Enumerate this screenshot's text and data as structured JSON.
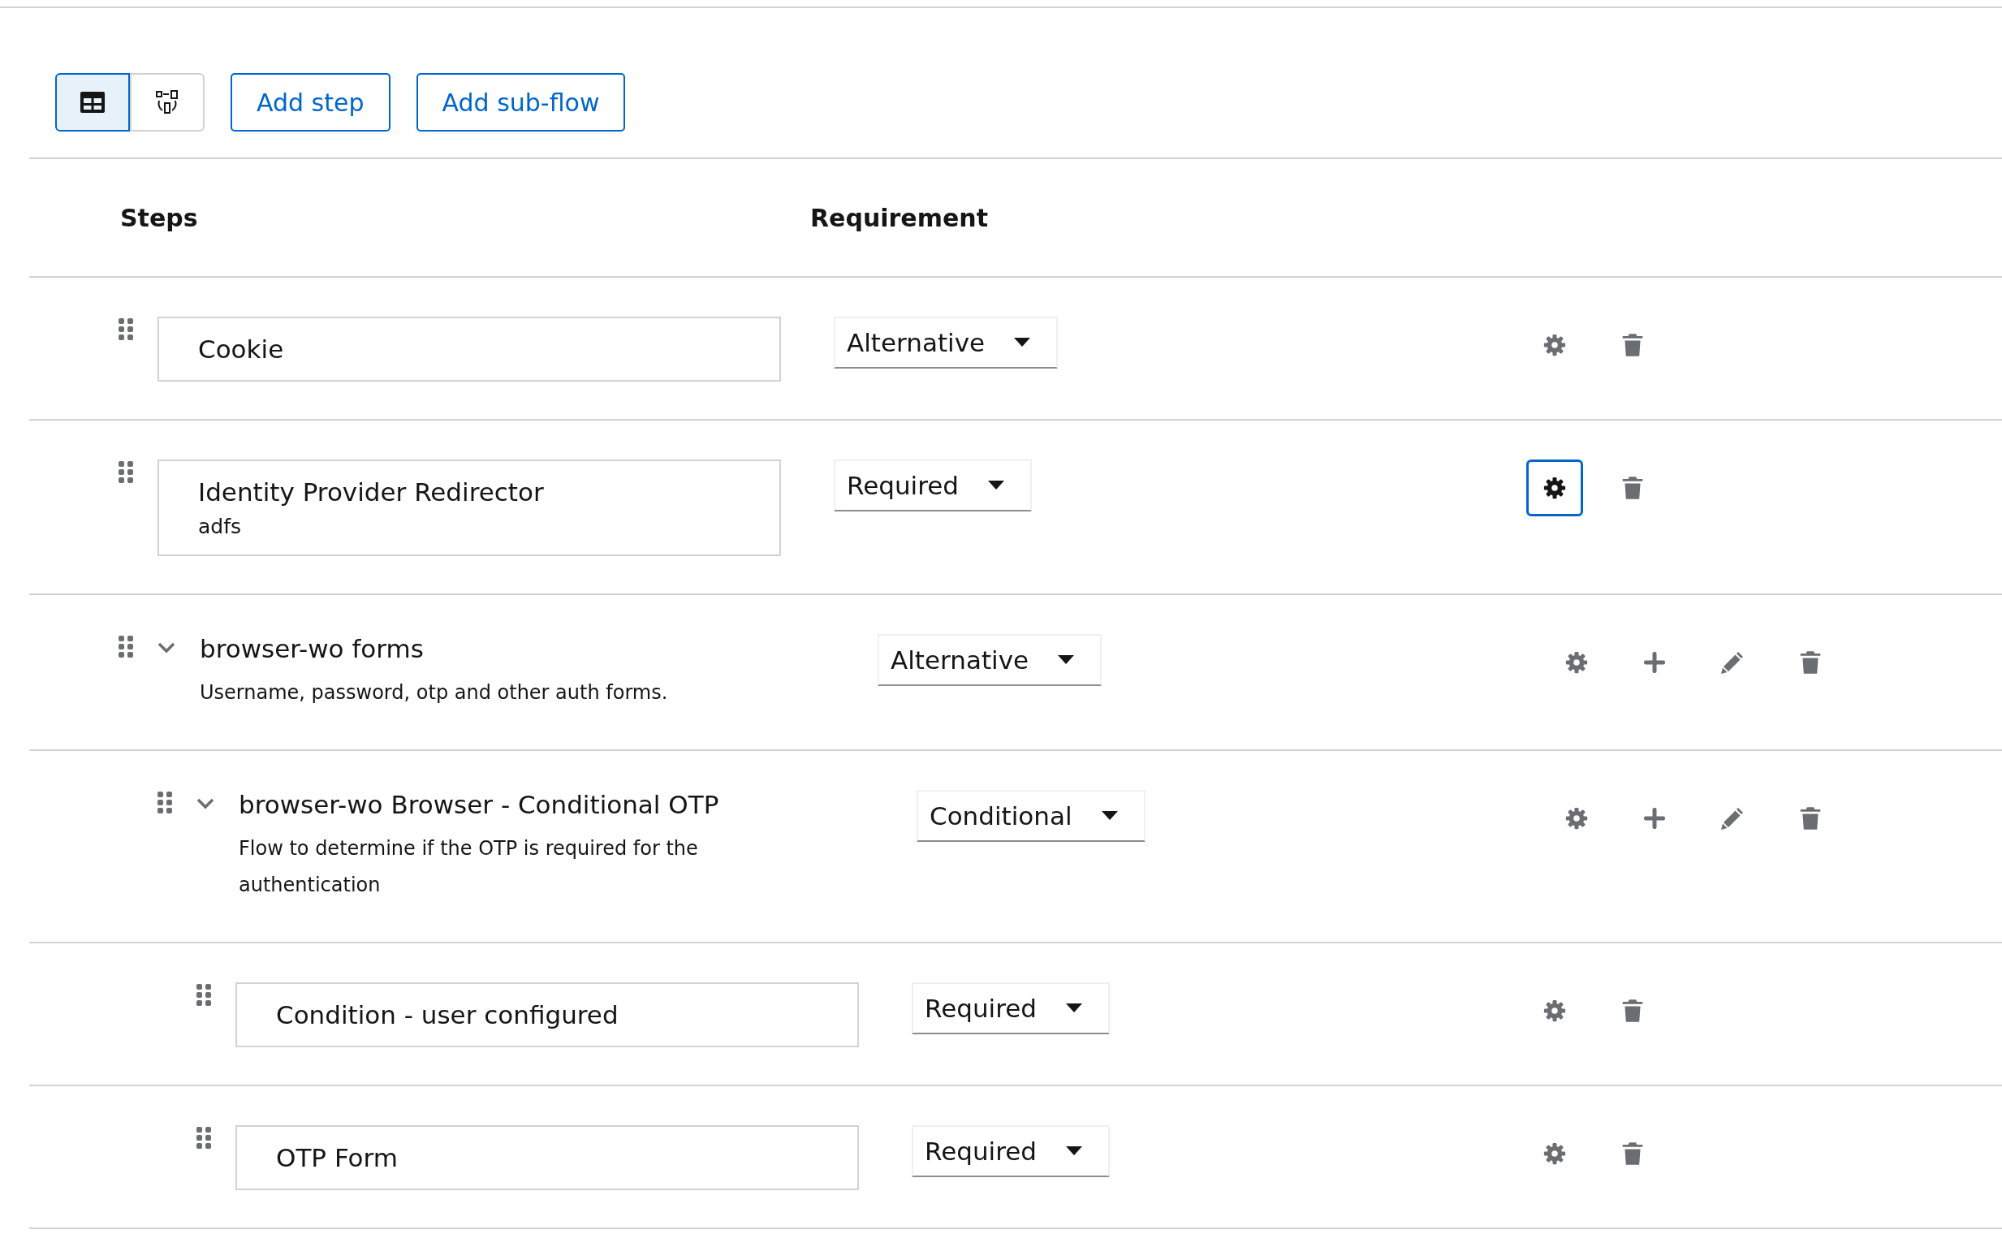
{
  "toolbar": {
    "view_toggle": [
      {
        "kind": "table",
        "selected": true
      },
      {
        "kind": "diagram",
        "selected": false
      }
    ],
    "buttons": [
      "Add step",
      "Add sub-flow"
    ]
  },
  "table": {
    "columns": [
      "Steps",
      "Requirement"
    ],
    "rows": [
      {
        "kind": "step",
        "name": "Cookie",
        "requirement": "Alternative",
        "settings_focused": false
      },
      {
        "kind": "step",
        "name": "Identity Provider Redirector",
        "alias": "adfs",
        "requirement": "Required",
        "settings_focused": true
      },
      {
        "kind": "flow",
        "name": "browser-wo forms",
        "description": "Username, password, otp and other auth forms.",
        "requirement": "Alternative",
        "expanded": true,
        "settings_focused": false,
        "children": [
          {
            "kind": "flow",
            "name": "browser-wo Browser - Conditional OTP",
            "description": "Flow to determine if the OTP is required for the authentication",
            "requirement": "Conditional",
            "expanded": true,
            "settings_focused": false,
            "children": [
              {
                "kind": "step",
                "name": "Condition - user configured",
                "requirement": "Required",
                "settings_focused": false
              },
              {
                "kind": "step",
                "name": "OTP Form",
                "requirement": "Required",
                "settings_focused": false
              }
            ]
          }
        ]
      }
    ]
  }
}
